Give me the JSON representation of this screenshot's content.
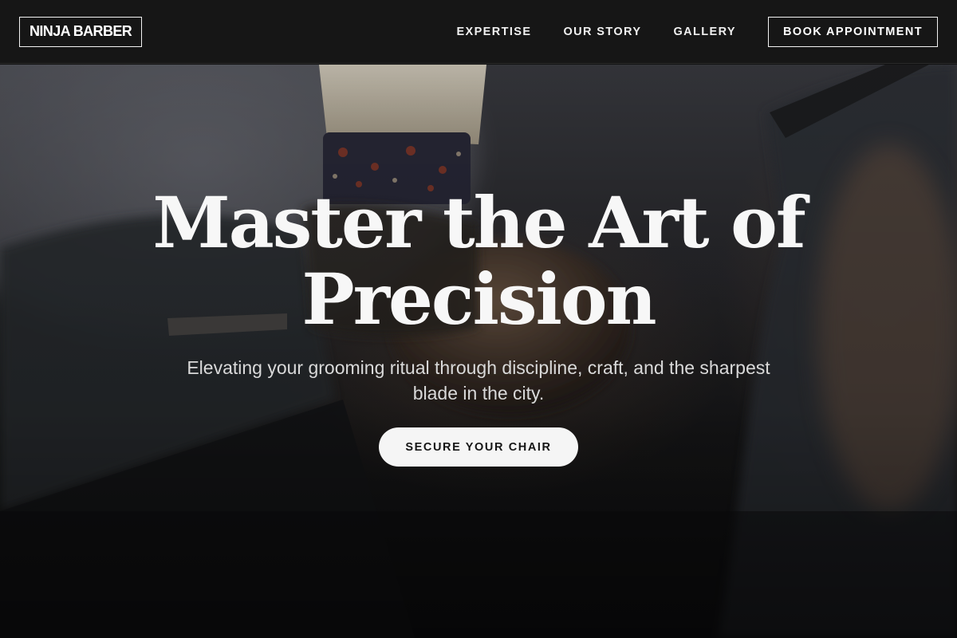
{
  "header": {
    "logo": "NINJA BARBER",
    "nav": [
      {
        "label": "EXPERTISE"
      },
      {
        "label": "OUR STORY"
      },
      {
        "label": "GALLERY"
      }
    ],
    "book_button": "BOOK APPOINTMENT"
  },
  "hero": {
    "title_line1": "Master the Art of",
    "title_line2": "Precision",
    "subtitle_line1": "Elevating your grooming ritual through discipline, craft, and the sharpest",
    "subtitle_line2": "blade in the city.",
    "cta": "SECURE YOUR CHAIR",
    "background_image": "barber-cutting-hair-photo"
  },
  "colors": {
    "header_bg": "#161616",
    "text": "#ffffff",
    "cta_bg": "#f5f5f5",
    "cta_text": "#151515"
  }
}
